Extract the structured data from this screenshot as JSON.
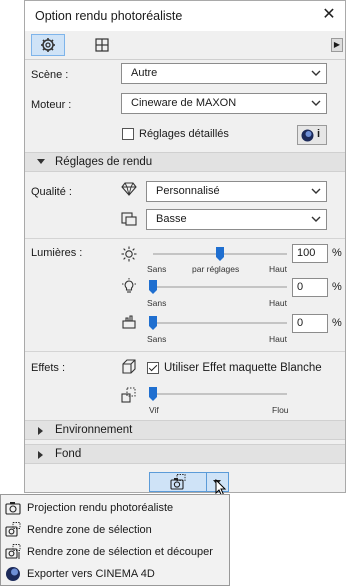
{
  "window": {
    "title": "Option rendu photoréaliste",
    "close": "✕"
  },
  "tabs": [
    {
      "name": "settings",
      "active": true
    },
    {
      "name": "crop",
      "active": false
    }
  ],
  "scene": {
    "label": "Scène :",
    "value": "Autre"
  },
  "engine": {
    "label": "Moteur :",
    "value": "Cineware de MAXON"
  },
  "detailed": {
    "label": "Réglages détaillés",
    "checked": false,
    "info": "i"
  },
  "render_settings": {
    "header": "Réglages de rendu",
    "quality_label": "Qualité :",
    "quality_value": "Personnalisé",
    "quality2_value": "Basse"
  },
  "lights": {
    "label": "Lumières :",
    "sun": {
      "value": "100",
      "unit": "%",
      "min": "Sans",
      "mid": "par réglages",
      "max": "Haut",
      "level": 0.5
    },
    "lamp": {
      "value": "0",
      "unit": "%",
      "min": "Sans",
      "max": "Haut",
      "level": 0.0
    },
    "ambient": {
      "value": "0",
      "unit": "%",
      "min": "Sans",
      "max": "Haut",
      "level": 0.0
    }
  },
  "effects": {
    "label": "Effets :",
    "white_model": "Utiliser Effet maquette Blanche",
    "white_model_checked": true,
    "slider_min": "Vif",
    "slider_max": "Flou",
    "level": 0.0
  },
  "environment": {
    "header": "Environnement"
  },
  "background": {
    "header": "Fond"
  },
  "menu": {
    "items": [
      {
        "label": "Projection rendu photoréaliste",
        "icon": "camera-icon"
      },
      {
        "label": "Rendre zone de sélection",
        "icon": "camera-selection-icon"
      },
      {
        "label": "Rendre zone de sélection et découper",
        "icon": "camera-crop-icon"
      },
      {
        "label": "Exporter vers CINEMA 4D",
        "icon": "cinema4d-icon"
      }
    ]
  },
  "colors": {
    "accent": "#1f6fd0",
    "tab_active": "#cfe3f7",
    "panel": "#f0f0f0"
  }
}
